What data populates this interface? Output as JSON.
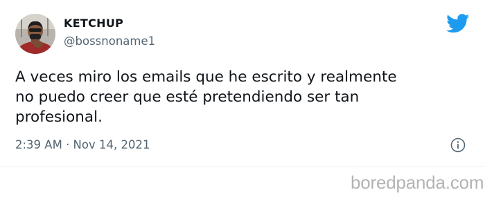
{
  "tweet": {
    "display_name": "KETCHUP",
    "handle": "@bossnoname1",
    "text_lines": [
      "A veces miro los emails que he escrito y realmente",
      "no puedo creer que esté pretendiendo ser tan",
      "profesional."
    ],
    "timestamp": "2:39 AM · Nov 14, 2021"
  },
  "icons": {
    "brand": "twitter-bird-icon",
    "info": "info-icon",
    "avatar": "user-avatar"
  },
  "colors": {
    "brand_blue": "#1d9bf0",
    "text_primary": "#0f1419",
    "text_secondary": "#536471",
    "watermark": "#b3b3b3"
  },
  "watermark": {
    "text": "boredpanda.com"
  }
}
